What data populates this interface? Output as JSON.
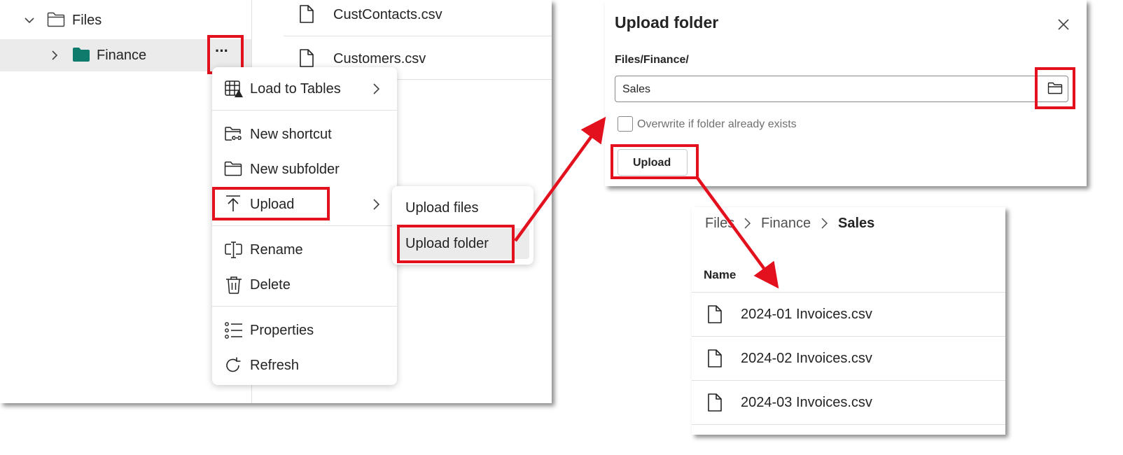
{
  "explorer": {
    "root_label": "Files",
    "folder_label": "Finance",
    "more_label": "···",
    "files": [
      "CustContacts.csv",
      "Customers.csv"
    ]
  },
  "context_menu": {
    "items": [
      {
        "label": "Load to Tables",
        "icon": "table-icon"
      },
      {
        "label": "New shortcut",
        "icon": "folder-link-icon"
      },
      {
        "label": "New subfolder",
        "icon": "folder-icon"
      },
      {
        "label": "Upload",
        "icon": "upload-icon"
      },
      {
        "label": "Rename",
        "icon": "rename-icon"
      },
      {
        "label": "Delete",
        "icon": "trash-icon"
      },
      {
        "label": "Properties",
        "icon": "list-icon"
      },
      {
        "label": "Refresh",
        "icon": "refresh-icon"
      }
    ]
  },
  "submenu": {
    "items": [
      "Upload files",
      "Upload folder"
    ]
  },
  "dialog": {
    "title": "Upload folder",
    "path_label": "Files/Finance/",
    "folder_value": "Sales",
    "overwrite_label": "Overwrite if folder already exists",
    "upload_button": "Upload"
  },
  "result": {
    "breadcrumb": [
      "Files",
      "Finance",
      "Sales"
    ],
    "column_name": "Name",
    "files": [
      "2024-01 Invoices.csv",
      "2024-02 Invoices.csv",
      "2024-03 Invoices.csv"
    ]
  },
  "colors": {
    "highlight": "#e3101d",
    "folder_fill": "#0f7b6c",
    "selected_row": "#ebebeb"
  }
}
